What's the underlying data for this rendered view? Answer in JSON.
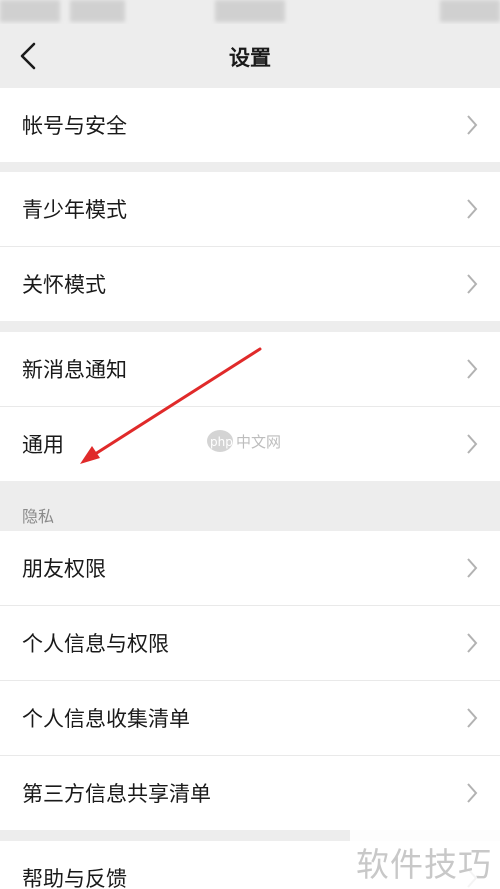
{
  "header": {
    "title": "设置",
    "back_icon": "chevron-left-icon"
  },
  "groups": [
    {
      "items": [
        {
          "label": "帐号与安全"
        }
      ]
    },
    {
      "items": [
        {
          "label": "青少年模式"
        },
        {
          "label": "关怀模式"
        }
      ]
    },
    {
      "items": [
        {
          "label": "新消息通知"
        },
        {
          "label": "通用"
        }
      ]
    },
    {
      "section": "隐私",
      "items": [
        {
          "label": "朋友权限"
        },
        {
          "label": "个人信息与权限"
        },
        {
          "label": "个人信息收集清单"
        },
        {
          "label": "第三方信息共享清单"
        }
      ]
    },
    {
      "items": [
        {
          "label": "帮助与反馈"
        }
      ]
    }
  ],
  "colors": {
    "background": "#ededed",
    "row": "#ffffff",
    "text": "#1a1a1a",
    "chevron": "#b2b2b2",
    "annotation": "#e02a2a"
  },
  "watermarks": {
    "center": "php中文网",
    "corner": "软件技巧"
  }
}
